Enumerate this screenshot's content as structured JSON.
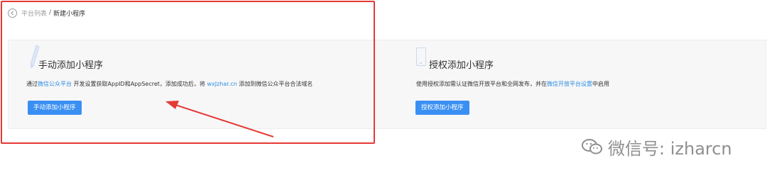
{
  "breadcrumb": {
    "parent": "平台列表",
    "separator": "/",
    "current": "新建小程序"
  },
  "manual_card": {
    "title": "手动添加小程序",
    "desc_pre": "通过",
    "desc_link1": "微信公众平台",
    "desc_mid": " 开发设置获取AppID和AppSecret，添加成功后，将 ",
    "desc_link2": "wxJzhar.cn",
    "desc_post": " 添加到微信公众平台合法域名",
    "button": "手动添加小程序"
  },
  "auth_card": {
    "title": "授权添加小程序",
    "desc_pre": "使用授权添加需认证微信开放平台和全网发布，并在",
    "desc_link": "微信开放平台设置",
    "desc_post": "中启用",
    "button": "授权添加小程序"
  },
  "watermark": {
    "text": "微信号: izharcn"
  },
  "colors": {
    "accent": "#3a8ff2",
    "link": "#2f8ee0",
    "annotation": "#e53935"
  }
}
